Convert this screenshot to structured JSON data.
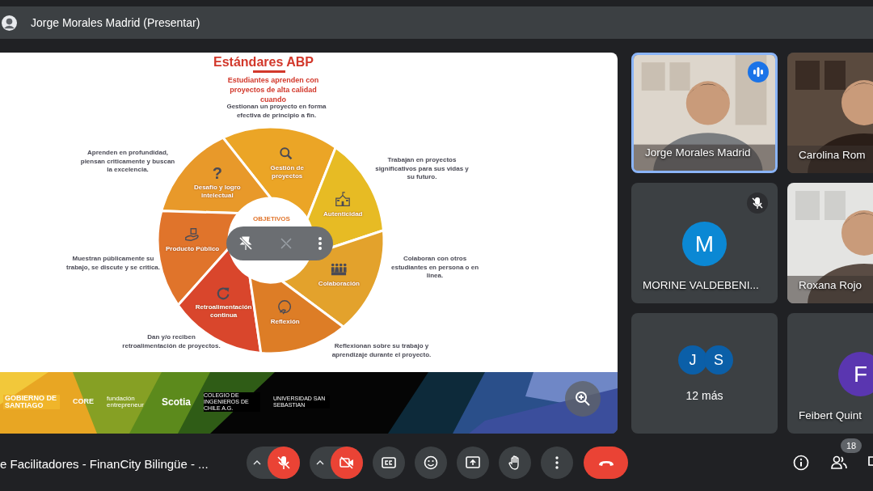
{
  "presenter_bar": {
    "name": "Jorge Morales Madrid (Presentar)"
  },
  "slide": {
    "title": "Estándares ABP",
    "subtitle": "Estudiantes aprenden con proyectos de alta calidad cuando",
    "center_label": "OBJETIVOS",
    "segments": [
      {
        "label": "Gestión de proyectos",
        "description": "Gestionan un proyecto en forma efectiva de principio a fin.",
        "color": "#eba526"
      },
      {
        "label": "Desafío y logro intelectual",
        "symbol": "?",
        "description": "Aprenden en profundidad, piensan criticamente y buscan la excelencia.",
        "color": "#e8992a"
      },
      {
        "label": "Autenticidad",
        "description": "Trabajan en proyectos significativos para sus vidas y su futuro.",
        "color": "#e7bb24"
      },
      {
        "label": "Producto Público",
        "description": "Muestran públicamente su trabajo, se discute y se critica.",
        "color": "#e0742b"
      },
      {
        "label": "Colaboración",
        "description": "Colaboran con otros estudiantes en persona o en linea.",
        "color": "#e3a22c"
      },
      {
        "label": "Retroalimentación continua",
        "description": "Dan y/o reciben retroalimentación de proyectos.",
        "color": "#d9462c"
      },
      {
        "label": "Reflexión",
        "description": "Reflexionan sobre su trabajo y aprendizaje durante el proyecto.",
        "color": "#dd7d26"
      }
    ],
    "logos": [
      "GOBIERNO DE SANTIAGO",
      "CORE",
      "fundación entrepreneur",
      "Scotia",
      "COLEGIO DE INGENIEROS DE CHILE A.G.",
      "UNIVERSIDAD SAN SEBASTIAN"
    ]
  },
  "tiles": [
    {
      "kind": "video",
      "name": "Jorge Morales Madrid",
      "speaking": true,
      "muted": false
    },
    {
      "kind": "video",
      "name": "Carolina Rom",
      "speaking": false,
      "muted": false
    },
    {
      "kind": "avatar",
      "name": "MORINE VALDEBENI...",
      "initial": "M",
      "color": "#0b88d4",
      "speaking": false,
      "muted": true
    },
    {
      "kind": "video",
      "name": "Roxana Rojo",
      "speaking": false,
      "muted": false
    },
    {
      "kind": "more",
      "label": "12 más",
      "avatars": [
        {
          "initial": "J",
          "color": "#0b5fa8"
        },
        {
          "initial": "S",
          "color": "#0b5fa8"
        }
      ],
      "speaking": false,
      "muted": false
    },
    {
      "kind": "avatar",
      "name": "Feibert Quint",
      "initial": "F",
      "color": "#5a36b0",
      "speaking": false,
      "muted": false
    }
  ],
  "meeting_title": "e Facilitadores - FinanCity Bilingüe - ...",
  "controls": {
    "mic_on": false,
    "camera_on": false
  },
  "participants_count": "18"
}
